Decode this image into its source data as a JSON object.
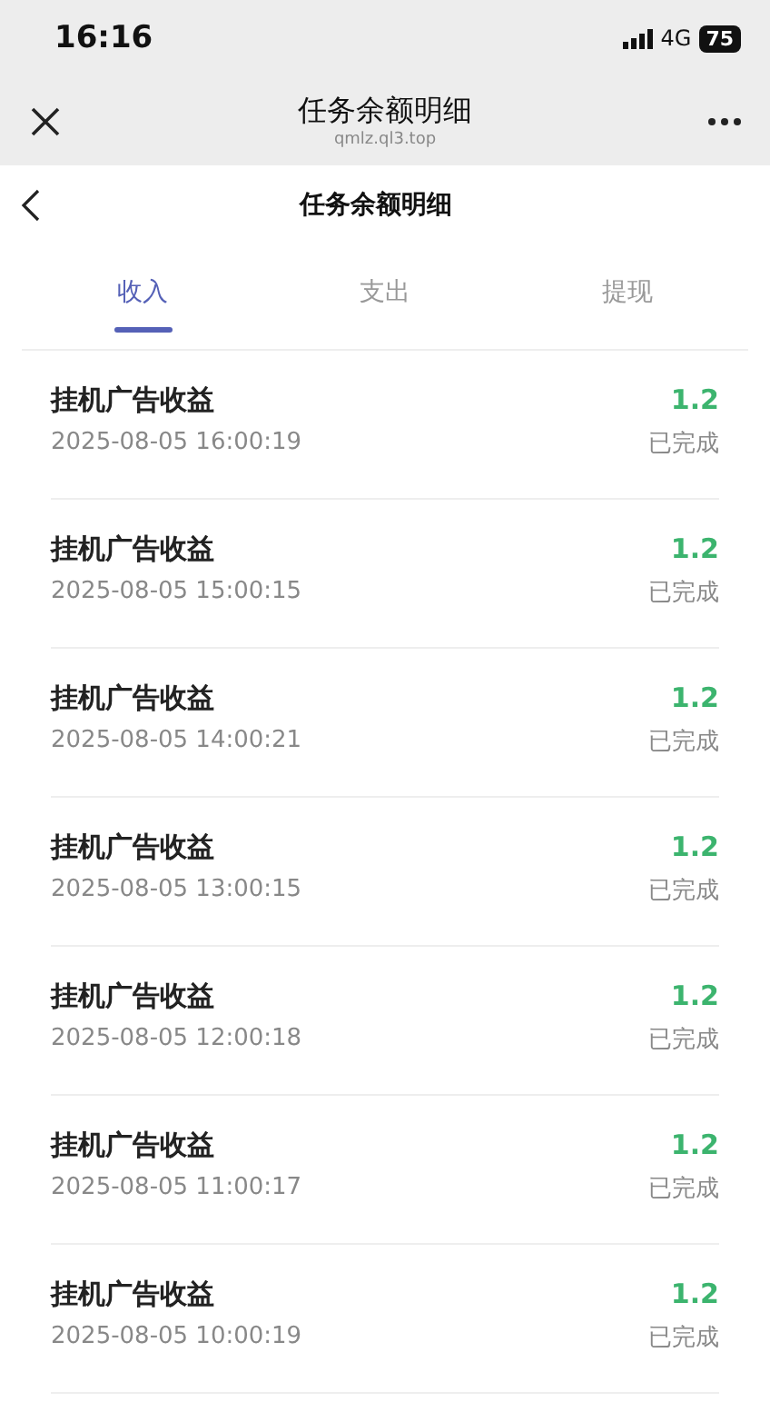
{
  "status_bar": {
    "time": "16:16",
    "network": "4G",
    "battery": "75"
  },
  "browser_bar": {
    "title": "任务余额明细",
    "url": "qmlz.ql3.top"
  },
  "header": {
    "title": "任务余额明细"
  },
  "tabs": [
    {
      "label": "收入",
      "selected": true
    },
    {
      "label": "支出",
      "selected": false
    },
    {
      "label": "提现",
      "selected": false
    }
  ],
  "records": [
    {
      "title": "挂机广告收益",
      "time": "2025-08-05 16:00:19",
      "amount": "1.2",
      "status": "已完成"
    },
    {
      "title": "挂机广告收益",
      "time": "2025-08-05 15:00:15",
      "amount": "1.2",
      "status": "已完成"
    },
    {
      "title": "挂机广告收益",
      "time": "2025-08-05 14:00:21",
      "amount": "1.2",
      "status": "已完成"
    },
    {
      "title": "挂机广告收益",
      "time": "2025-08-05 13:00:15",
      "amount": "1.2",
      "status": "已完成"
    },
    {
      "title": "挂机广告收益",
      "time": "2025-08-05 12:00:18",
      "amount": "1.2",
      "status": "已完成"
    },
    {
      "title": "挂机广告收益",
      "time": "2025-08-05 11:00:17",
      "amount": "1.2",
      "status": "已完成"
    },
    {
      "title": "挂机广告收益",
      "time": "2025-08-05 10:00:19",
      "amount": "1.2",
      "status": "已完成"
    }
  ]
}
